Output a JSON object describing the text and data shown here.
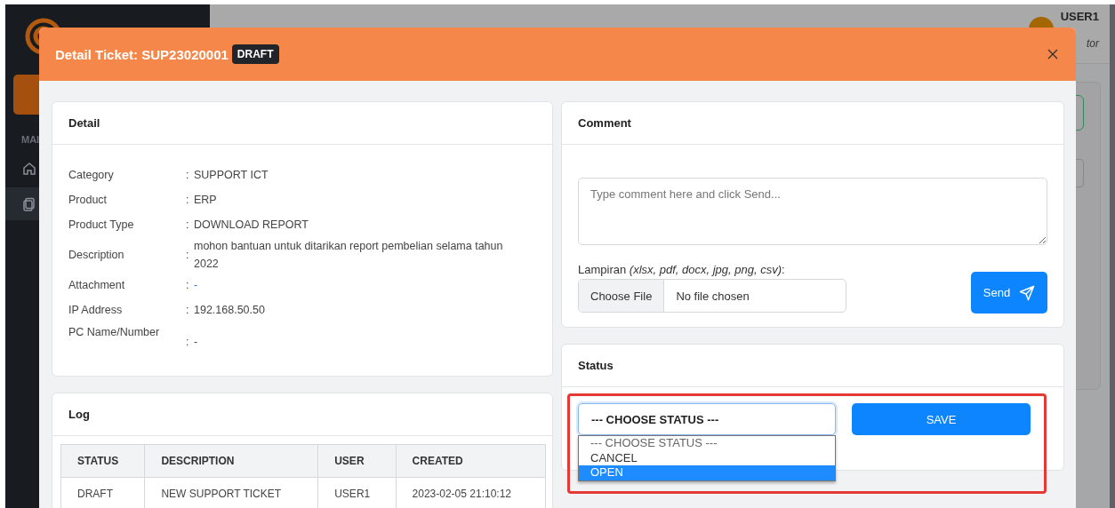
{
  "background": {
    "sidebar_section": "MAI",
    "user_name": "USER1",
    "user_role": "tor"
  },
  "modal": {
    "title": "Detail Ticket: SUP23020001",
    "badge": "DRAFT"
  },
  "detail": {
    "title": "Detail",
    "fields": [
      {
        "label": "Category",
        "separator": ":",
        "value": "SUPPORT ICT",
        "kind": "text"
      },
      {
        "label": "Product",
        "separator": ":",
        "value": "ERP",
        "kind": "text"
      },
      {
        "label": "Product Type",
        "separator": ":",
        "value": "DOWNLOAD REPORT",
        "kind": "text"
      },
      {
        "label": "Description",
        "separator": ":",
        "value": "mohon bantuan untuk ditarikan report pembelian selama tahun 2022",
        "kind": "text"
      },
      {
        "label": "Attachment",
        "separator": ":",
        "value": "-",
        "kind": "link"
      },
      {
        "label": "IP Address",
        "separator": ":",
        "value": "192.168.50.50",
        "kind": "text"
      },
      {
        "label": "PC Name/Number",
        "separator": ":",
        "value": "-",
        "kind": "low"
      }
    ]
  },
  "comment": {
    "title": "Comment",
    "placeholder": "Type comment here and click Send...",
    "attachment_label": "Lampiran *(xlsx, pdf, docx, jpg, png, csv)*:",
    "file_button": "Choose File",
    "file_status": "No file chosen",
    "send_button": "Send"
  },
  "status": {
    "title": "Status",
    "select_value": "--- CHOOSE STATUS ---",
    "expanded": true,
    "options": [
      {
        "label": "--- CHOOSE STATUS ---",
        "selected": false
      },
      {
        "label": "CANCEL",
        "selected": false
      },
      {
        "label": "OPEN",
        "selected": true
      }
    ],
    "save_button": "SAVE"
  },
  "log": {
    "title": "Log",
    "columns": [
      "STATUS",
      "DESCRIPTION",
      "USER",
      "CREATED"
    ],
    "rows": [
      [
        "DRAFT",
        "NEW SUPPORT TICKET",
        "USER1",
        "2023-02-05 21:10:12"
      ]
    ]
  }
}
